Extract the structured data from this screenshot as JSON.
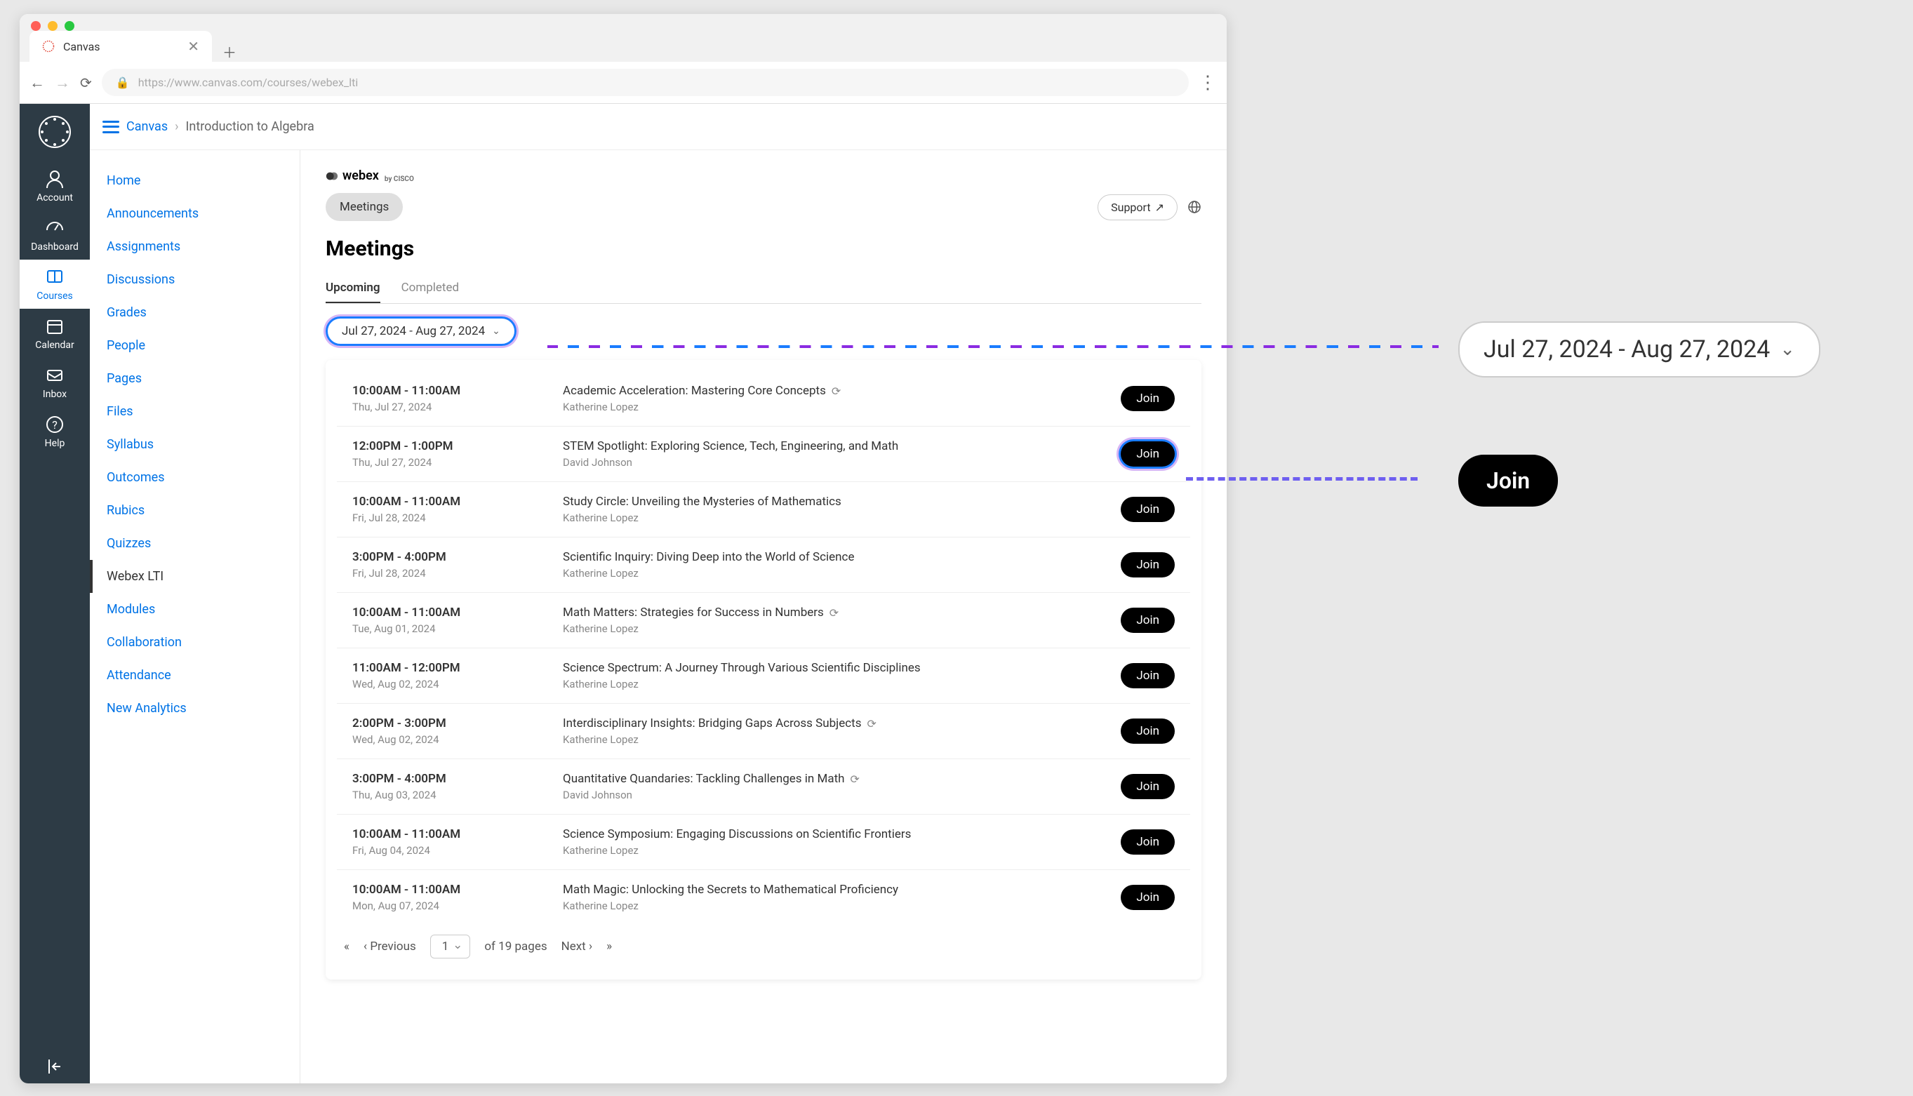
{
  "browser": {
    "tab_title": "Canvas",
    "url": "https://www.canvas.com/courses/webex_lti"
  },
  "canvas_nav": [
    {
      "label": "Account"
    },
    {
      "label": "Dashboard"
    },
    {
      "label": "Courses"
    },
    {
      "label": "Calendar"
    },
    {
      "label": "Inbox"
    },
    {
      "label": "Help"
    }
  ],
  "breadcrumb": {
    "root": "Canvas",
    "course": "Introduction to Algebra"
  },
  "sidebar_links": [
    "Home",
    "Announcements",
    "Assignments",
    "Discussions",
    "Grades",
    "People",
    "Pages",
    "Files",
    "Syllabus",
    "Outcomes",
    "Rubics",
    "Quizzes",
    "Webex LTI",
    "Modules",
    "Collaboration",
    "Attendance",
    "New Analytics"
  ],
  "sidebar_active": "Webex LTI",
  "webex": {
    "brand": "webex",
    "sub": "by CISCO",
    "support": "Support",
    "chip": "Meetings",
    "title": "Meetings",
    "tabs": {
      "upcoming": "Upcoming",
      "completed": "Completed"
    },
    "date_range": "Jul 27, 2024 - Aug 27, 2024"
  },
  "meetings": [
    {
      "time": "10:00AM - 11:00AM",
      "date": "Thu, Jul 27, 2024",
      "title": "Academic Acceleration: Mastering Core Concepts",
      "recurring": true,
      "host": "Katherine Lopez",
      "join": "Join"
    },
    {
      "time": "12:00PM - 1:00PM",
      "date": "Thu, Jul 27, 2024",
      "title": "STEM Spotlight: Exploring Science, Tech, Engineering, and Math",
      "recurring": false,
      "host": "David Johnson",
      "join": "Join"
    },
    {
      "time": "10:00AM - 11:00AM",
      "date": "Fri, Jul 28, 2024",
      "title": "Study Circle: Unveiling the Mysteries of Mathematics",
      "recurring": false,
      "host": "Katherine Lopez",
      "join": "Join"
    },
    {
      "time": "3:00PM - 4:00PM",
      "date": "Fri, Jul 28, 2024",
      "title": "Scientific Inquiry: Diving Deep into the World of Science",
      "recurring": false,
      "host": "Katherine Lopez",
      "join": "Join"
    },
    {
      "time": "10:00AM - 11:00AM",
      "date": "Tue, Aug 01, 2024",
      "title": "Math Matters: Strategies for Success in Numbers",
      "recurring": true,
      "host": "Katherine Lopez",
      "join": "Join"
    },
    {
      "time": "11:00AM - 12:00PM",
      "date": "Wed, Aug 02, 2024",
      "title": "Science Spectrum: A Journey Through Various Scientific Disciplines",
      "recurring": false,
      "host": "Katherine Lopez",
      "join": "Join"
    },
    {
      "time": "2:00PM - 3:00PM",
      "date": "Wed, Aug 02, 2024",
      "title": "Interdisciplinary Insights: Bridging Gaps Across Subjects",
      "recurring": true,
      "host": "Katherine Lopez",
      "join": "Join"
    },
    {
      "time": "3:00PM - 4:00PM",
      "date": "Thu, Aug 03, 2024",
      "title": "Quantitative Quandaries: Tackling Challenges in Math",
      "recurring": true,
      "host": "David Johnson",
      "join": "Join"
    },
    {
      "time": "10:00AM - 11:00AM",
      "date": "Fri, Aug 04, 2024",
      "title": "Science Symposium: Engaging Discussions on Scientific Frontiers",
      "recurring": false,
      "host": "Katherine Lopez",
      "join": "Join"
    },
    {
      "time": "10:00AM - 11:00AM",
      "date": "Mon, Aug 07, 2024",
      "title": "Math Magic: Unlocking the Secrets to Mathematical Proficiency",
      "recurring": false,
      "host": "Katherine Lopez",
      "join": "Join"
    }
  ],
  "pager": {
    "previous": "Previous",
    "current": "1",
    "of_pages": "of 19 pages",
    "next": "Next"
  },
  "callouts": {
    "date": "Jul 27, 2024 - Aug 27, 2024",
    "join": "Join"
  }
}
